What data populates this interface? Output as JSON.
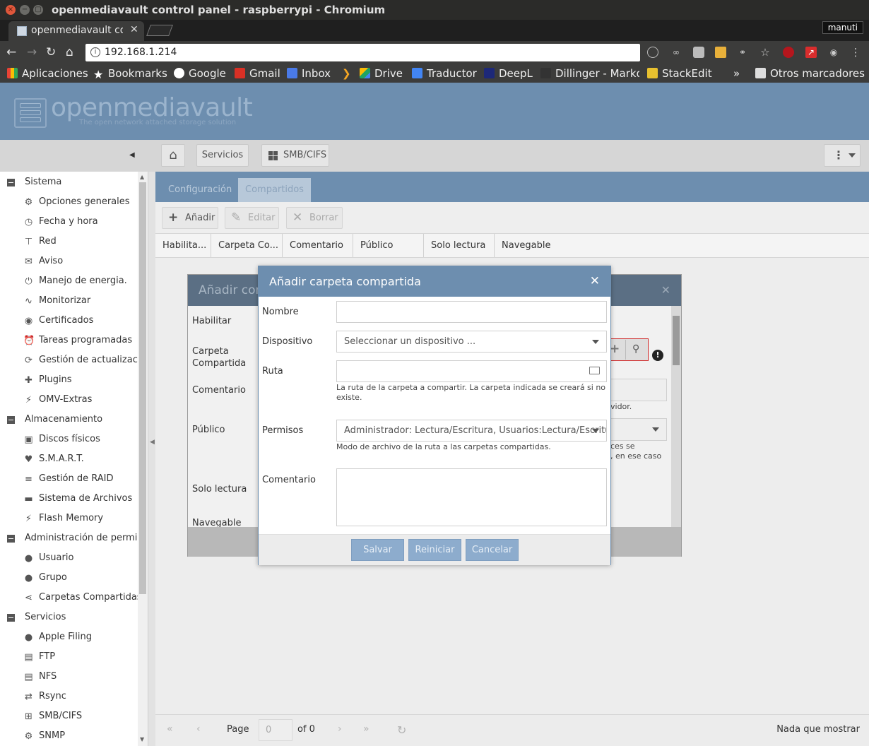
{
  "window": {
    "title": "openmediavault control panel - raspberrypi - Chromium",
    "controls": {
      "close": "×",
      "minimize": "−",
      "maximize": "▢"
    }
  },
  "browser": {
    "tab_title": "openmediavault co",
    "tab_close": "✕",
    "profile": "manuti",
    "url": "192.168.1.214",
    "bookmarks": [
      {
        "label": "Aplicaciones",
        "color": "#e94335"
      },
      {
        "label": "Bookmarks",
        "color": "#ffffff"
      },
      {
        "label": "Google",
        "color": "#4285f4"
      },
      {
        "label": "Gmail",
        "color": "#d93025"
      },
      {
        "label": "Inbox",
        "color": "#4a7ae8"
      },
      {
        "label": "Drive",
        "color": "#1fa463"
      },
      {
        "label": "Traductor",
        "color": "#4285f4"
      },
      {
        "label": "DeepL",
        "color": "#1d2878"
      },
      {
        "label": "Dillinger - Markd",
        "color": "#333333"
      },
      {
        "label": "StackEdit",
        "color": "#e8c12f"
      }
    ],
    "bookmarks_more": "»",
    "other_bookmarks": "Otros marcadores"
  },
  "omv": {
    "brand": "openmediavault",
    "tagline": "The open network attached storage solution"
  },
  "breadcrumb": {
    "services": "Servicios",
    "smb": "SMB/CIFS"
  },
  "sidebar": {
    "categories": [
      {
        "label": "Sistema",
        "items": [
          {
            "label": "Opciones generales",
            "icon": "⚙"
          },
          {
            "label": "Fecha y hora",
            "icon": "◷"
          },
          {
            "label": "Red",
            "icon": "⊤"
          },
          {
            "label": "Aviso",
            "icon": "✉"
          },
          {
            "label": "Manejo de energia.",
            "icon": "⏻"
          },
          {
            "label": "Monitorizar",
            "icon": "∿"
          },
          {
            "label": "Certificados",
            "icon": "◉"
          },
          {
            "label": "Tareas programadas",
            "icon": "⏰"
          },
          {
            "label": "Gestión de actualizacio",
            "icon": "⟳"
          },
          {
            "label": "Plugins",
            "icon": "✚"
          },
          {
            "label": "OMV-Extras",
            "icon": "⚡"
          }
        ]
      },
      {
        "label": "Almacenamiento",
        "items": [
          {
            "label": "Discos físicos",
            "icon": "▣"
          },
          {
            "label": "S.M.A.R.T.",
            "icon": "♥"
          },
          {
            "label": "Gestión de RAID",
            "icon": "≡"
          },
          {
            "label": "Sistema de Archivos",
            "icon": "▬"
          },
          {
            "label": "Flash Memory",
            "icon": "⚡"
          }
        ]
      },
      {
        "label": "Administración de permiso",
        "items": [
          {
            "label": "Usuario",
            "icon": "●"
          },
          {
            "label": "Grupo",
            "icon": "●"
          },
          {
            "label": "Carpetas Compartidas",
            "icon": "⋖"
          }
        ]
      },
      {
        "label": "Servicios",
        "items": [
          {
            "label": "Apple Filing",
            "icon": "●"
          },
          {
            "label": "FTP",
            "icon": "▤"
          },
          {
            "label": "NFS",
            "icon": "▤"
          },
          {
            "label": "Rsync",
            "icon": "⇄"
          },
          {
            "label": "SMB/CIFS",
            "icon": "⊞"
          },
          {
            "label": "SNMP",
            "icon": "⚙"
          }
        ]
      }
    ]
  },
  "main": {
    "tabs": [
      "Configuración",
      "Compartidos"
    ],
    "toolbar": {
      "add": "Añadir",
      "edit": "Editar",
      "delete": "Borrar"
    },
    "columns": [
      "Habilita...",
      "Carpeta Co...",
      "Comentario",
      "Público",
      "Solo lectura",
      "Navegable"
    ],
    "pager": {
      "page_label": "Page",
      "page_value": "0",
      "of_label": "of 0",
      "empty": "Nada que mostrar"
    }
  },
  "bg_window": {
    "title": "Añadir com",
    "close": "✕",
    "labels": [
      "Habilitar",
      "Carpeta Compartida",
      "Comentario",
      "Público",
      "Solo lectura",
      "Navegable"
    ],
    "partial_hint1": "vidor.",
    "partial_hint2a": "ces se",
    "partial_hint2b": ", en ese caso"
  },
  "dialog": {
    "title": "Añadir carpeta compartida",
    "close": "✕",
    "name_label": "Nombre",
    "name_value": "",
    "device_label": "Dispositivo",
    "device_placeholder": "Seleccionar un dispositivo ...",
    "path_label": "Ruta",
    "path_value": "",
    "path_hint": "La ruta de la carpeta a compartir. La carpeta indicada se creará si no existe.",
    "perm_label": "Permisos",
    "perm_value": "Administrador: Lectura/Escritura, Usuarios:Lectura/Escritura",
    "perm_hint": "Modo de archivo de la ruta a las carpetas compartidas.",
    "comment_label": "Comentario",
    "comment_value": "",
    "buttons": {
      "save": "Salvar",
      "reset": "Reiniciar",
      "cancel": "Cancelar"
    }
  }
}
